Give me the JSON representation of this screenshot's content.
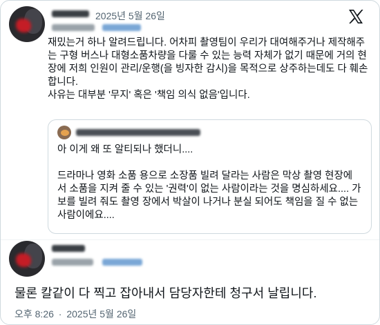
{
  "tweet": {
    "date": "2025년 5월 26일",
    "body": "재밌는거 하나 알려드립니다. 어차피 촬영팀이 우리가 대여해주거나 제작해주는 구형 버스나 대형소품차량을 다룰 수 있는 능력 자체가 없기 때문에 거의 현장에 저희 인원이 관리/운행(을 빙자한 감시)을 목적으로 상주하는데도 다 훼손합니다.\n사유는 대부분 '무지' 혹은 '책임 의식 없음'입니다."
  },
  "quote": {
    "body": "아 이게 왜 또 알티되나 했더니....\n\n드라마나 영화 소품 용으로 소장품 빌려 달라는 사람은 막상 촬영 현장에서 소품을 지켜 줄 수 있는 '권력'이 없는 사람이라는 것을 명심하세요.... 가보를 빌려 줘도 촬영 장에서 박살이 나거나 분실 되어도 책임을 질 수 없는 사람이에요...."
  },
  "reply": {
    "text": "물론 칼같이 다 찍고 잡아내서 담당자한테 청구서 날립니다.",
    "time": "오후 8:26",
    "separator": "·",
    "date": "2025년 5월 26일"
  },
  "icons": {
    "x_logo": "x-logo-icon"
  }
}
